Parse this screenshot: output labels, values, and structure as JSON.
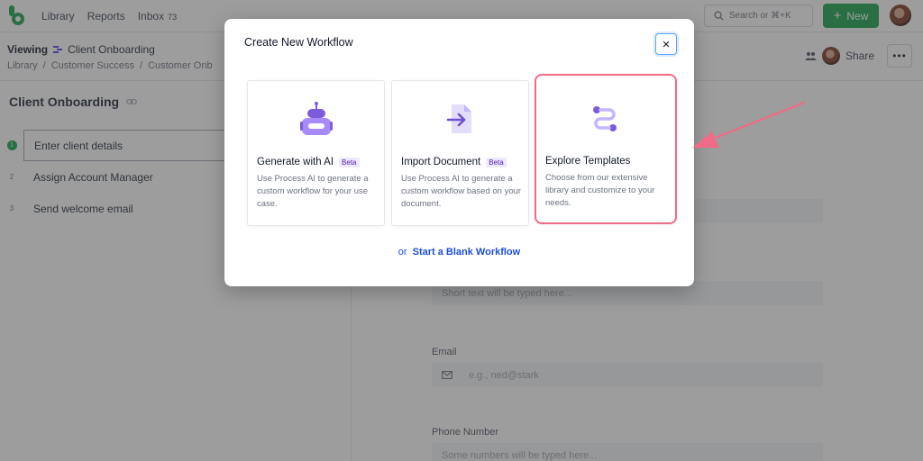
{
  "nav": {
    "library": "Library",
    "reports": "Reports",
    "inbox": "Inbox",
    "inbox_count": "73"
  },
  "search": {
    "placeholder": "Search or ⌘+K"
  },
  "new_button": {
    "label": "New"
  },
  "viewing": {
    "label": "Viewing",
    "title": "Client Onboarding"
  },
  "breadcrumbs": [
    "Library",
    "/",
    "Customer Success",
    "/",
    "Customer Onb"
  ],
  "share": {
    "label": "Share"
  },
  "workflow": {
    "title": "Client Onboarding",
    "steps": [
      {
        "num": "1",
        "label": "Enter client details"
      },
      {
        "num": "2",
        "label": "Assign Account Manager"
      },
      {
        "num": "3",
        "label": "Send welcome email"
      }
    ]
  },
  "form": {
    "short_text_placeholder": "Short text will be typed here...",
    "email_label": "Email",
    "email_placeholder": "e.g., ned@stark",
    "phone_label": "Phone Number",
    "phone_placeholder": "Some numbers will be typed here..."
  },
  "modal": {
    "title": "Create New Workflow",
    "close_label": "×",
    "cards": [
      {
        "title": "Generate with AI",
        "badge": "Beta",
        "desc": "Use Process AI to generate a custom workflow for your use case.",
        "icon": "robot-icon"
      },
      {
        "title": "Import Document",
        "badge": "Beta",
        "desc": "Use Process AI to generate a custom workflow based on your document.",
        "icon": "import-document-icon"
      },
      {
        "title": "Explore Templates",
        "badge": "",
        "desc": "Choose from our extensive library and customize to your needs.",
        "icon": "templates-icon"
      }
    ],
    "blank_prefix": "or",
    "blank_link": "Start a Blank Workflow"
  },
  "colors": {
    "accent": "#16a34a",
    "highlight": "#f06c86",
    "icon_purple": "#7c5cdb",
    "link": "#1d4ed8"
  }
}
